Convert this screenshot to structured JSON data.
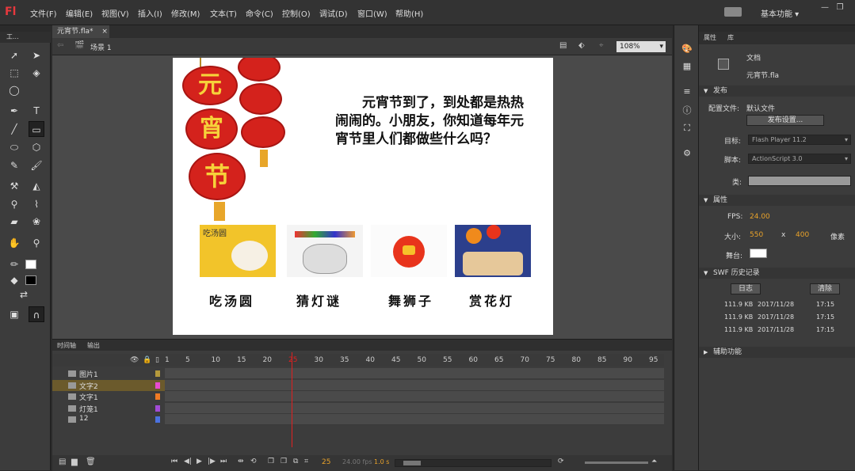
{
  "app": {
    "logo": "Fl",
    "workspace": "基本功能 ▾"
  },
  "menu": [
    "文件(F)",
    "编辑(E)",
    "视图(V)",
    "插入(I)",
    "修改(M)",
    "文本(T)",
    "命令(C)",
    "控制(O)",
    "调试(D)",
    "窗口(W)",
    "帮助(H)"
  ],
  "tools_header": "工...",
  "document": {
    "tab": "元宵节.fla*",
    "scene": "场景 1",
    "zoom": "108%"
  },
  "stage": {
    "lantern_chars": [
      "元",
      "宵",
      "节"
    ],
    "text": "元宵节到了，到处都是热热闹闹的。小朋友，你知道每年元宵节里人们都做些什么吗？",
    "pic1_text": "吃汤圆",
    "captions": [
      "吃汤圆",
      "猜灯谜",
      "舞狮子",
      "赏花灯"
    ]
  },
  "properties": {
    "tabs": [
      "属性",
      "库"
    ],
    "doc_label": "文档",
    "doc_name": "元宵节.fla",
    "publish_section": "发布",
    "profile_label": "配置文件:",
    "profile_value": "默认文件",
    "publish_settings": "发布设置...",
    "target_label": "目标:",
    "target_value": "Flash Player 11.2",
    "script_label": "脚本:",
    "script_value": "ActionScript 3.0",
    "class_label": "类:",
    "props_section": "属性",
    "fps_label": "FPS:",
    "fps_value": "24.00",
    "size_label": "大小:",
    "width": "550",
    "x": "x",
    "height": "400",
    "unit": "像素",
    "stage_label": "舞台:",
    "stage_color": "#ffffff",
    "history_section": "SWF 历史记录",
    "log_button": "日志",
    "clear_button": "清除",
    "history": [
      {
        "size": "111.9 KB",
        "date": "2017/11/28",
        "time": "17:15"
      },
      {
        "size": "111.9 KB",
        "date": "2017/11/28",
        "time": "17:15"
      },
      {
        "size": "111.9 KB",
        "date": "2017/11/28",
        "time": "17:15"
      }
    ],
    "accessibility_section": "辅助功能"
  },
  "timeline": {
    "tabs": [
      "时间轴",
      "输出"
    ],
    "ruler": [
      "1",
      "5",
      "10",
      "15",
      "20",
      "25",
      "30",
      "35",
      "40",
      "45",
      "50",
      "55",
      "60",
      "65",
      "70",
      "75",
      "80",
      "85",
      "90",
      "95"
    ],
    "layers": [
      {
        "name": "图片1",
        "color": "#b59a3c"
      },
      {
        "name": "文字2",
        "color": "#e84bd0"
      },
      {
        "name": "文字1",
        "color": "#f07a24"
      },
      {
        "name": "灯笼1",
        "color": "#a24bd6"
      },
      {
        "name": "12",
        "color": "#4b72e0"
      }
    ],
    "current_frame": "25",
    "fps_display": "24.00 fps",
    "time": "1.0 s"
  }
}
